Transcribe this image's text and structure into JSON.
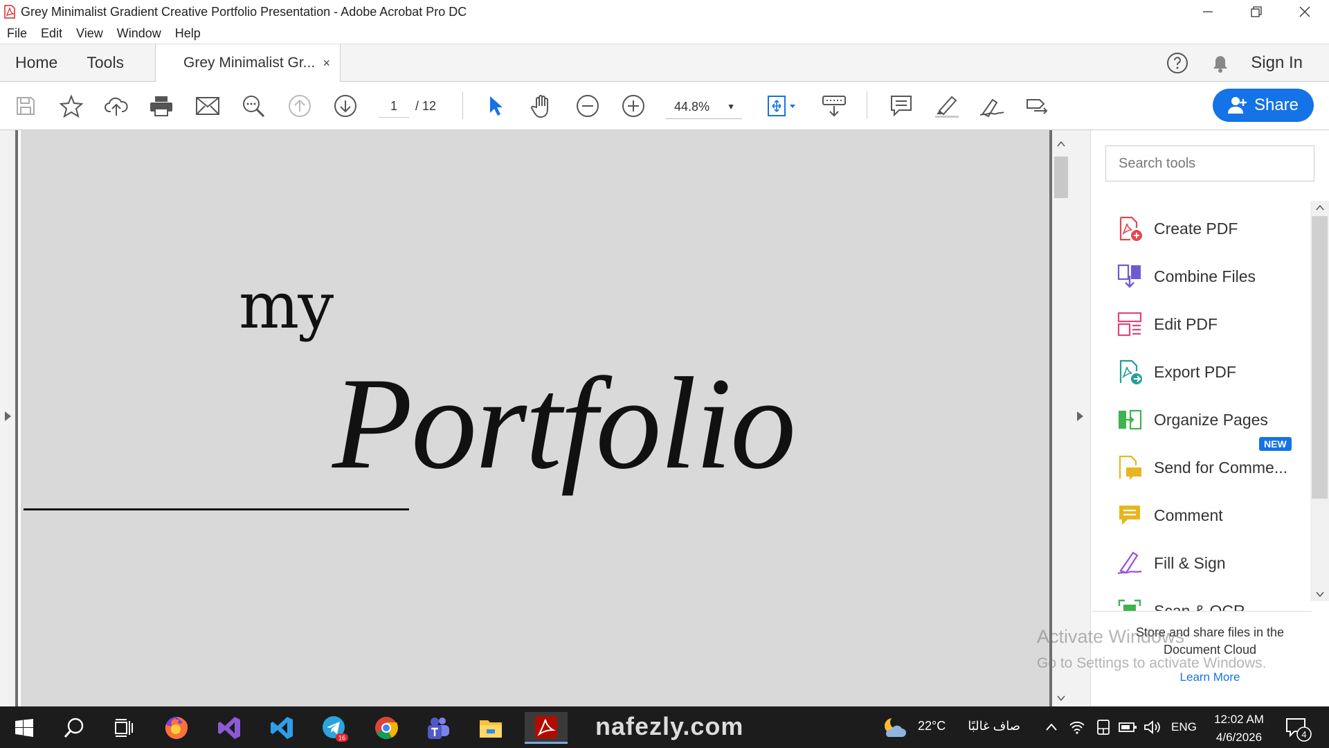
{
  "window": {
    "title": "Grey Minimalist Gradient Creative Portfolio Presentation - Adobe Acrobat Pro DC"
  },
  "menu": [
    "File",
    "Edit",
    "View",
    "Window",
    "Help"
  ],
  "tabs": {
    "home": "Home",
    "tools": "Tools",
    "document": "Grey Minimalist Gr...",
    "close": "×",
    "sign_in": "Sign In"
  },
  "toolbar": {
    "page_current": "1",
    "page_total": "/ 12",
    "zoom": "44.8%",
    "share": "Share"
  },
  "document": {
    "line1": "my",
    "line2": "Portfolio"
  },
  "tools_pane": {
    "search_placeholder": "Search tools",
    "items": [
      {
        "label": "Create PDF",
        "icon": "create-pdf-icon",
        "color": "#e34850"
      },
      {
        "label": "Combine Files",
        "icon": "combine-files-icon",
        "color": "#6e5ad4"
      },
      {
        "label": "Edit PDF",
        "icon": "edit-pdf-icon",
        "color": "#e0457b"
      },
      {
        "label": "Export PDF",
        "icon": "export-pdf-icon",
        "color": "#269e98"
      },
      {
        "label": "Organize Pages",
        "icon": "organize-pages-icon",
        "color": "#3fb34f"
      },
      {
        "label": "Send for Comme...",
        "icon": "send-for-comments-icon",
        "color": "#e9b51f"
      },
      {
        "label": "Comment",
        "icon": "comment-icon",
        "color": "#e9b51f"
      },
      {
        "label": "Fill & Sign",
        "icon": "fill-sign-icon",
        "color": "#9a4fd3"
      },
      {
        "label": "Scan & OCR",
        "icon": "scan-ocr-icon",
        "color": "#3fb34f"
      }
    ],
    "new_badge": "NEW",
    "cloud_text": "Store and share files in the Document Cloud",
    "learn_more": "Learn More"
  },
  "activation": {
    "line1": "Activate Windows",
    "line2": "Go to Settings to activate Windows."
  },
  "taskbar": {
    "watermark": "nafezly.com",
    "weather": "22°C",
    "weather_text": "صاف غالبًا",
    "language": "ENG",
    "time": "12:02 AM",
    "date": "4/6/2026",
    "notifications": "4",
    "telegram_badge": "16"
  },
  "colors": {
    "accent": "#1473e6",
    "page_bg": "#d9d9d9"
  }
}
